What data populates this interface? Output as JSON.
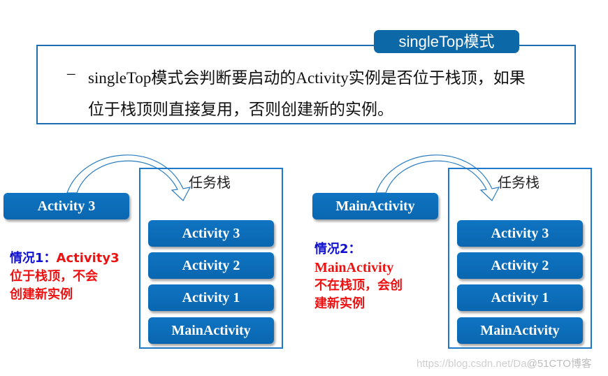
{
  "header": {
    "mode_label": "singleTop模式",
    "bullet_dash": "–",
    "description_line1": "singleTop模式会判断要启动的Activity实例是否位于栈顶，如果",
    "description_line2": "位于栈顶则直接复用，否则创建新的实例。"
  },
  "case1": {
    "launching_activity": "Activity 3",
    "stack_title": "任务栈",
    "stack": [
      "Activity 3",
      "Activity 2",
      "Activity 1",
      "MainActivity"
    ],
    "caption_prefix": "情况1：",
    "caption_highlight": "Activity3",
    "caption_line2": "位于栈顶，不会",
    "caption_line3": "创建新实例"
  },
  "case2": {
    "launching_activity": "MainActivity",
    "stack_title": "任务栈",
    "stack": [
      "Activity 3",
      "Activity 2",
      "Activity 1",
      "MainActivity"
    ],
    "caption_prefix": "情况2：",
    "caption_line2": "MainActivity",
    "caption_line3": "不在栈顶，会创",
    "caption_line4": "建新实例"
  },
  "colors": {
    "primary_blue": "#0d68a8",
    "border_blue": "#1f78c8",
    "case_label_blue": "#1010d0",
    "case_text_red": "#ee1111"
  },
  "watermark": {
    "url_text": "https://blog.csdn.net/Da",
    "brand_text": "@51CTO博客"
  }
}
